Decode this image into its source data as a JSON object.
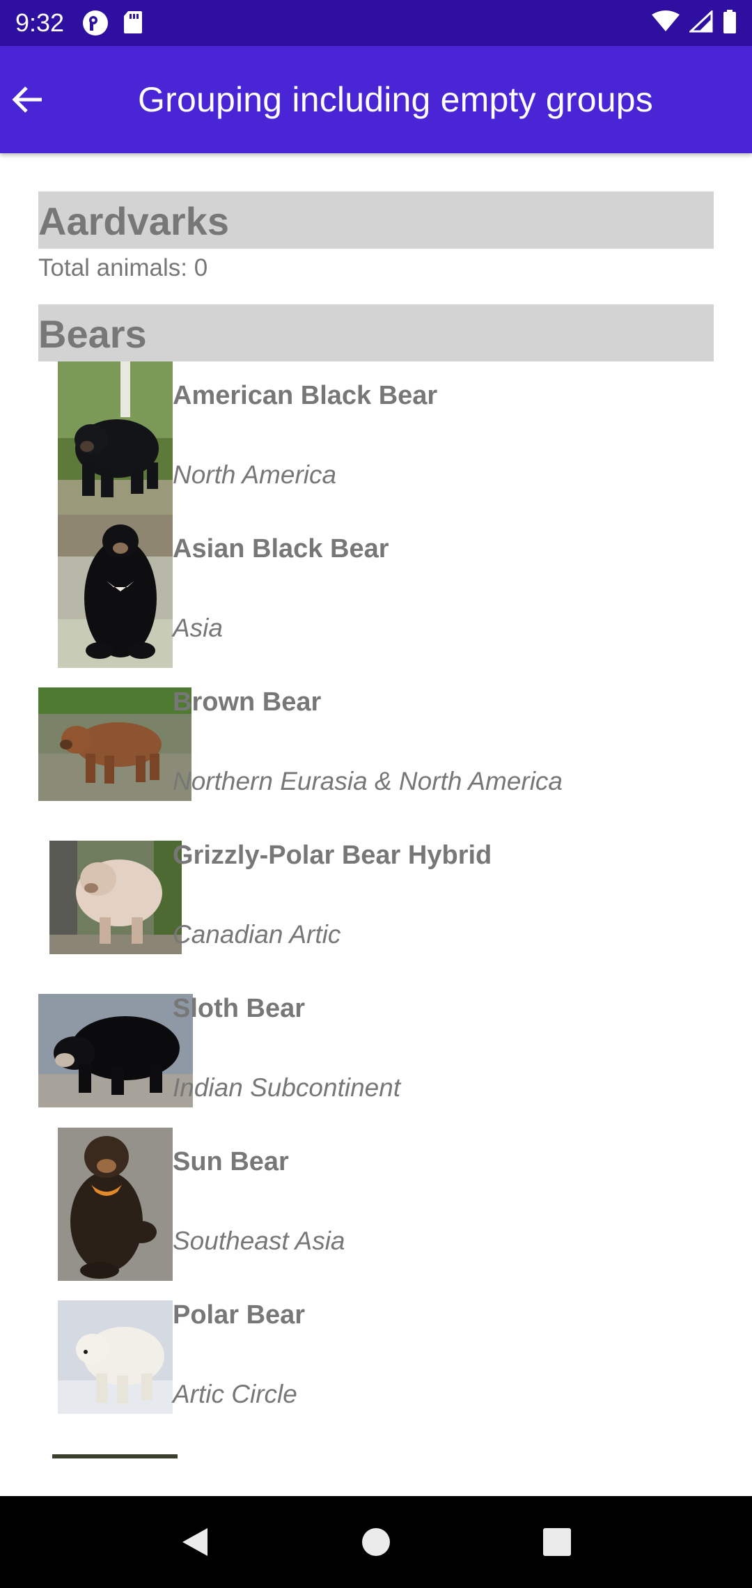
{
  "status_bar": {
    "time": "9:32",
    "left_icons": [
      "profile-icon",
      "sd-card-icon"
    ],
    "right_icons": [
      "wifi-icon",
      "signal-icon",
      "battery-icon"
    ]
  },
  "app_bar": {
    "title": "Grouping including empty groups",
    "back_icon": "arrow-back-icon"
  },
  "groups": [
    {
      "name": "Aardvarks",
      "footer": "Total animals: 0",
      "animals": []
    },
    {
      "name": "Bears",
      "animals": [
        {
          "name": "American Black Bear",
          "location": "North America",
          "photo": "american-black-bear"
        },
        {
          "name": "Asian Black Bear",
          "location": "Asia",
          "photo": "asian-black-bear"
        },
        {
          "name": "Brown Bear",
          "location": "Northern Eurasia & North America",
          "photo": "brown-bear"
        },
        {
          "name": "Grizzly-Polar Bear Hybrid",
          "location": "Canadian Artic",
          "photo": "grizzly-polar-bear"
        },
        {
          "name": "Sloth Bear",
          "location": "Indian Subcontinent",
          "photo": "sloth-bear"
        },
        {
          "name": "Sun Bear",
          "location": "Southeast Asia",
          "photo": "sun-bear"
        },
        {
          "name": "Polar Bear",
          "location": "Artic Circle",
          "photo": "polar-bear"
        }
      ]
    }
  ],
  "nav_bar": {
    "buttons": [
      "back-triangle-icon",
      "home-circle-icon",
      "recents-square-icon"
    ]
  },
  "colors": {
    "status_bar": "#2e0fa0",
    "app_bar": "#4a25d6",
    "group_header_bg": "#d3d3d3",
    "text_gray": "#777777"
  }
}
